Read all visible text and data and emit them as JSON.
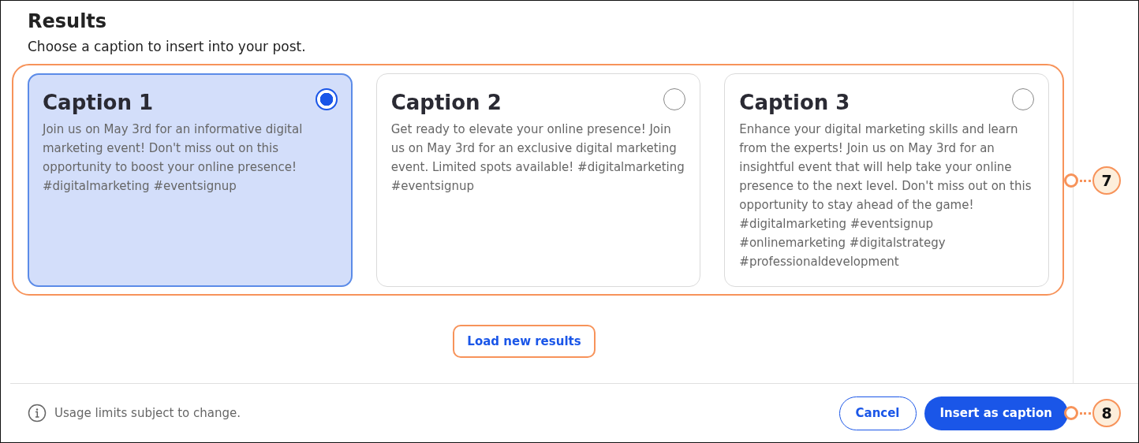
{
  "heading": "Results",
  "subtitle": "Choose a caption to insert into your post.",
  "captions": [
    {
      "title": "Caption 1",
      "text": "Join us on May 3rd for an informative digital marketing event! Don't miss out on this opportunity to boost your online presence! #digitalmarketing #eventsignup",
      "selected": true
    },
    {
      "title": "Caption 2",
      "text": "Get ready to elevate your online presence! Join us on May 3rd for an exclusive digital marketing event. Limited spots available! #digitalmarketing #eventsignup",
      "selected": false
    },
    {
      "title": "Caption 3",
      "text": "Enhance your digital marketing skills and learn from the experts! Join us on May 3rd for an insightful event that will help take your online presence to the next level. Don't miss out on this opportunity to stay ahead of the game! #digitalmarketing #eventsignup #onlinemarketing #digitalstrategy #professionaldevelopment",
      "selected": false
    }
  ],
  "load_button": "Load new results",
  "footer": {
    "note": "Usage limits subject to change.",
    "cancel": "Cancel",
    "insert": "Insert as caption"
  },
  "callouts": [
    {
      "label": "7"
    },
    {
      "label": "8"
    }
  ]
}
